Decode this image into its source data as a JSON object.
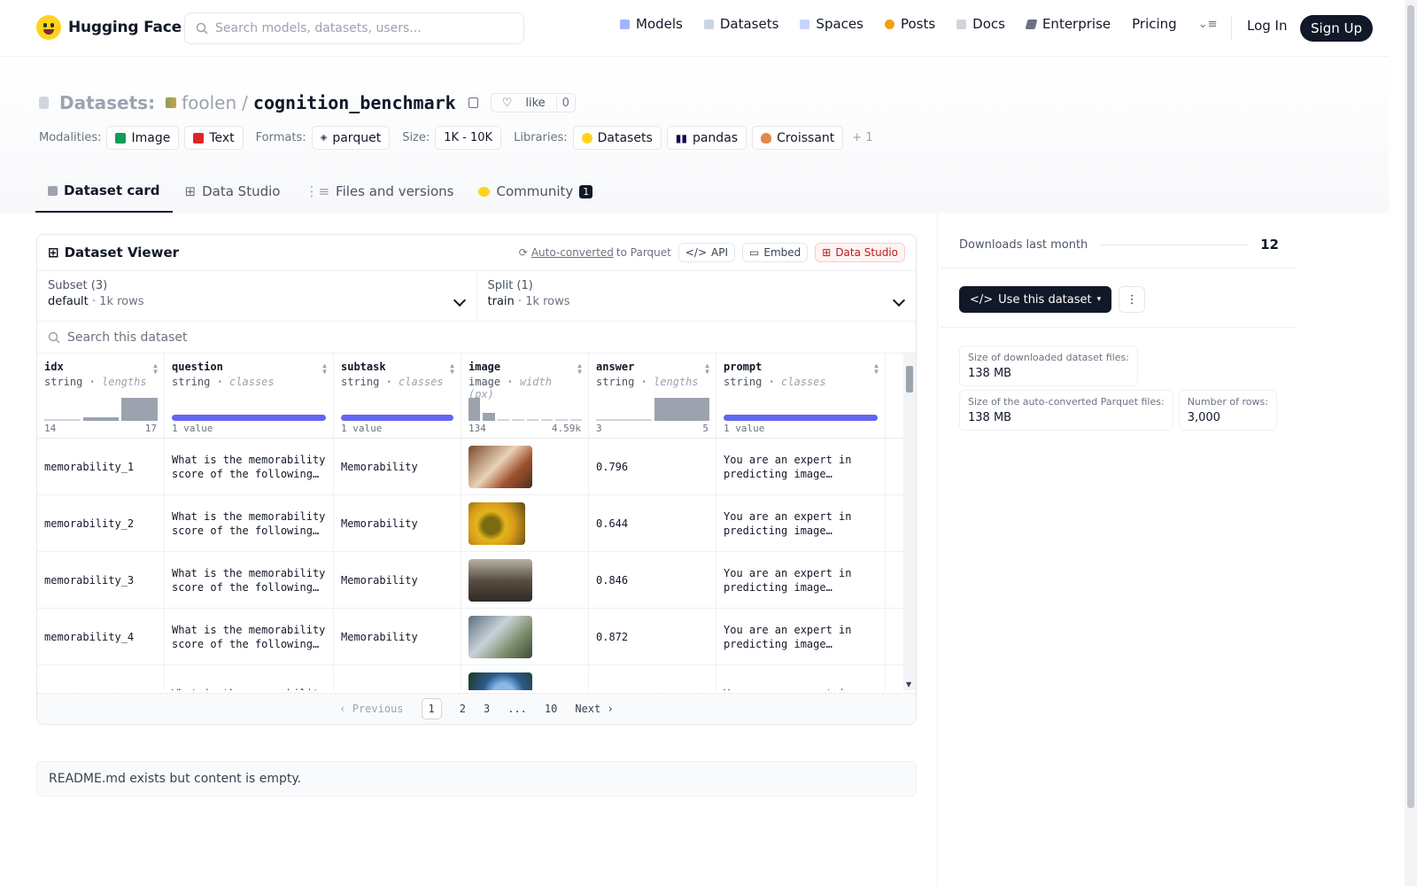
{
  "nav": {
    "brand": "Hugging Face",
    "search_placeholder": "Search models, datasets, users...",
    "links": [
      "Models",
      "Datasets",
      "Spaces",
      "Posts",
      "Docs",
      "Enterprise",
      "Pricing"
    ],
    "login": "Log In",
    "signup": "Sign Up"
  },
  "header": {
    "section": "Datasets:",
    "owner": "foolen",
    "sep": "/",
    "dataset": "cognition_benchmark",
    "like_label": "like",
    "like_count": "0",
    "modalities_label": "Modalities:",
    "modalities": [
      "Image",
      "Text"
    ],
    "formats_label": "Formats:",
    "format": "parquet",
    "size_label": "Size:",
    "size": "1K - 10K",
    "libraries_label": "Libraries:",
    "libraries": [
      "Datasets",
      "pandas",
      "Croissant"
    ],
    "more_libs": "+ 1"
  },
  "tabs": {
    "card": "Dataset card",
    "studio": "Data Studio",
    "files": "Files and versions",
    "community": "Community",
    "community_count": "1"
  },
  "viewer": {
    "title": "Dataset Viewer",
    "autoconv": "Auto-converted",
    "to_parquet": "to Parquet",
    "api": "API",
    "embed": "Embed",
    "data_studio": "Data Studio",
    "subset_label": "Subset (3)",
    "subset_value": "default",
    "subset_rows": "1k rows",
    "split_label": "Split (1)",
    "split_value": "train",
    "split_rows": "1k rows",
    "search_placeholder": "Search this dataset",
    "columns": [
      {
        "name": "idx",
        "type": "string",
        "meta": "lengths",
        "min": "14",
        "max": "17",
        "hist": [
          0.06,
          0.14,
          1.0
        ]
      },
      {
        "name": "question",
        "type": "string",
        "meta": "classes",
        "min": "1 value",
        "max": "",
        "hist": []
      },
      {
        "name": "subtask",
        "type": "string",
        "meta": "classes",
        "min": "1 value",
        "max": "",
        "hist": []
      },
      {
        "name": "image",
        "type": "image",
        "meta": "width (px)",
        "min": "134",
        "max": "4.59k",
        "hist": [
          1.0,
          0.35,
          0.05,
          0.05,
          0.05,
          0.05,
          0.05,
          0.05
        ]
      },
      {
        "name": "answer",
        "type": "string",
        "meta": "lengths",
        "min": "3",
        "max": "5",
        "hist": [
          0.06,
          1.0
        ]
      },
      {
        "name": "prompt",
        "type": "string",
        "meta": "classes",
        "min": "1 value",
        "max": "",
        "hist": []
      }
    ],
    "rows": [
      {
        "idx": "memorability_1",
        "question": "What is the memorability score of the following…",
        "subtask": "Memorability",
        "answer": "0.796",
        "prompt": "You are an expert in predicting image…"
      },
      {
        "idx": "memorability_2",
        "question": "What is the memorability score of the following…",
        "subtask": "Memorability",
        "answer": "0.644",
        "prompt": "You are an expert in predicting image…"
      },
      {
        "idx": "memorability_3",
        "question": "What is the memorability score of the following…",
        "subtask": "Memorability",
        "answer": "0.846",
        "prompt": "You are an expert in predicting image…"
      },
      {
        "idx": "memorability_4",
        "question": "What is the memorability score of the following…",
        "subtask": "Memorability",
        "answer": "0.872",
        "prompt": "You are an expert in predicting image…"
      },
      {
        "idx": "",
        "question": "What is the memorability",
        "subtask": "",
        "answer": "",
        "prompt": "You are an expert in"
      }
    ],
    "pager": {
      "prev": "Previous",
      "pages": [
        "1",
        "2",
        "3",
        "...",
        "10"
      ],
      "next": "Next"
    }
  },
  "readme": "README.md exists but content is empty.",
  "sidebar": {
    "downloads_label": "Downloads last month",
    "downloads": "12",
    "use_button": "Use this dataset",
    "dl_size_label": "Size of downloaded dataset files:",
    "dl_size": "138 MB",
    "parquet_size_label": "Size of the auto-converted Parquet files:",
    "parquet_size": "138 MB",
    "rows_label": "Number of rows:",
    "rows": "3,000"
  }
}
